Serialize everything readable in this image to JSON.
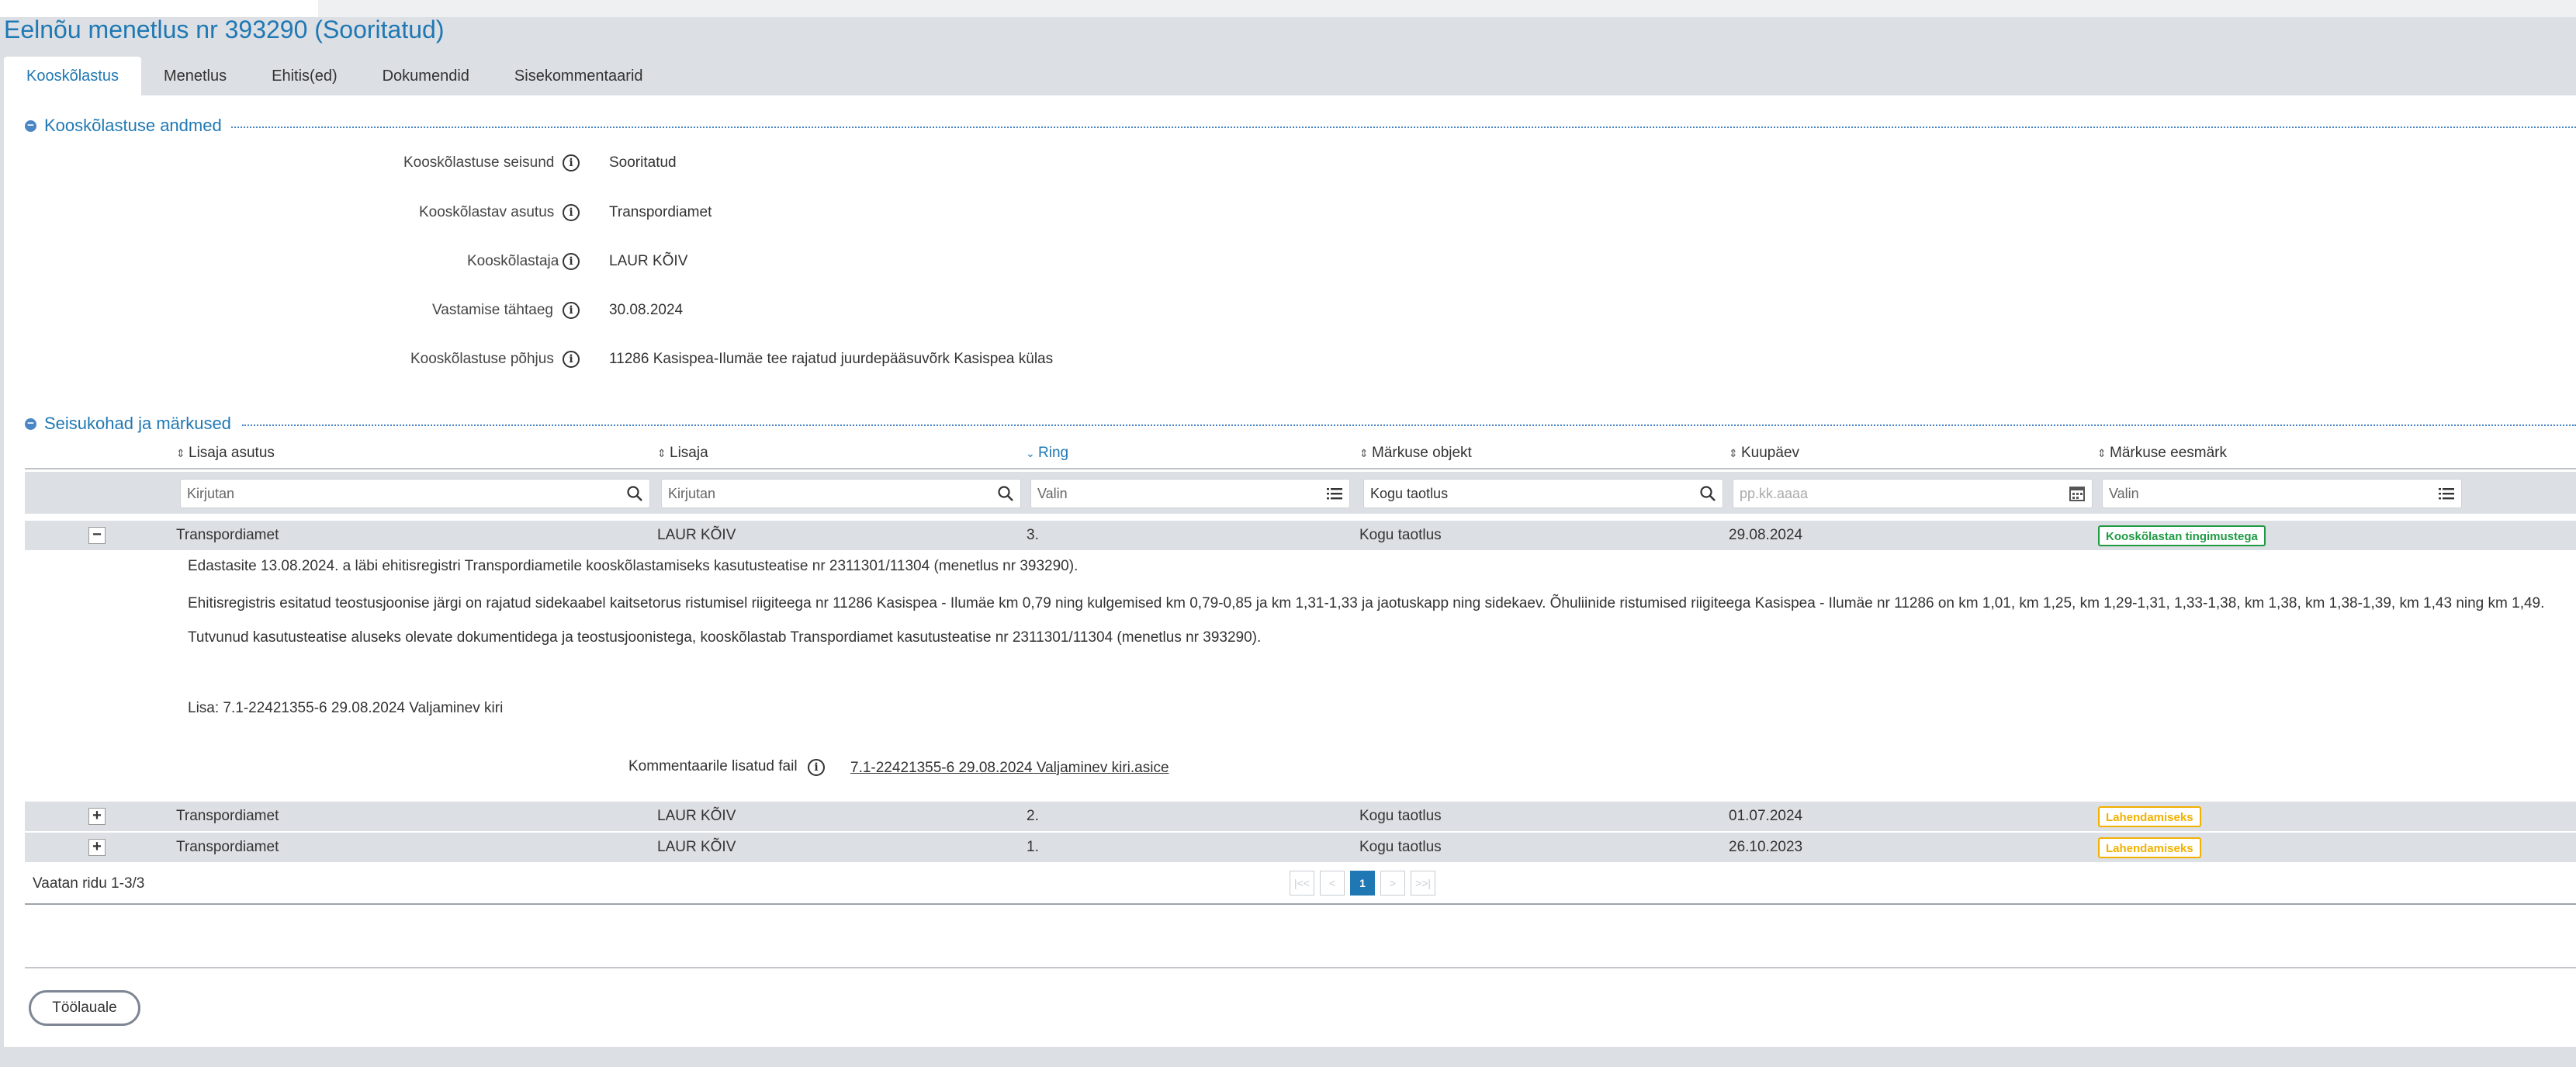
{
  "page": {
    "title": "Eelnõu menetlus nr 393290 (Sooritatud)"
  },
  "tabs": [
    {
      "label": "Kooskõlastus",
      "active": true
    },
    {
      "label": "Menetlus",
      "active": false
    },
    {
      "label": "Ehitis(ed)",
      "active": false
    },
    {
      "label": "Dokumendid",
      "active": false
    },
    {
      "label": "Sisekommentaarid",
      "active": false
    }
  ],
  "section1": {
    "title": "Kooskõlastuse andmed",
    "fields": [
      {
        "label": "Kooskõlastuse seisund",
        "value": "Sooritatud"
      },
      {
        "label": "Kooskõlastav asutus",
        "value": "Transpordiamet"
      },
      {
        "label": "Kooskõlastaja",
        "value": "LAUR KÕIV"
      },
      {
        "label": "Vastamise tähtaeg",
        "value": "30.08.2024"
      },
      {
        "label": "Kooskõlastuse põhjus",
        "value": "11286 Kasispea-Ilumäe tee rajatud juurdepääsuvõrk Kasispea külas"
      }
    ]
  },
  "section2": {
    "title": "Seisukohad ja märkused",
    "columns": [
      {
        "label": "Lisaja asutus",
        "sort": "unsorted"
      },
      {
        "label": "Lisaja",
        "sort": "unsorted"
      },
      {
        "label": "Ring",
        "sort": "descending"
      },
      {
        "label": "Märkuse objekt",
        "sort": "unsorted"
      },
      {
        "label": "Kuupäev",
        "sort": "unsorted"
      },
      {
        "label": "Märkuse eesmärk",
        "sort": "unsorted"
      }
    ],
    "filters": [
      {
        "placeholder": "Kirjutan",
        "icon": "search-icon"
      },
      {
        "placeholder": "Kirjutan",
        "icon": "search-icon"
      },
      {
        "placeholder": "Valin",
        "icon": "list-icon"
      },
      {
        "placeholder": "Kogu taotlus",
        "icon": "search-icon"
      },
      {
        "placeholder": "pp.kk.aaaa",
        "icon": "calendar-icon"
      },
      {
        "placeholder": "Valin",
        "icon": "list-icon"
      }
    ],
    "rows": [
      {
        "toggle": "−",
        "expanded": true,
        "organization": "Transpordiamet",
        "author": "LAUR KÕIV",
        "round": "3.",
        "object": "Kogu taotlus",
        "date": "29.08.2024",
        "purpose": "Kooskõlastan tingimustega",
        "purpose_color": "#1f9a43"
      },
      {
        "toggle": "+",
        "expanded": false,
        "organization": "Transpordiamet",
        "author": "LAUR KÕIV",
        "round": "2.",
        "object": "Kogu taotlus",
        "date": "01.07.2024",
        "purpose": "Lahendamiseks",
        "purpose_color": "#f2b100"
      },
      {
        "toggle": "+",
        "expanded": false,
        "organization": "Transpordiamet",
        "author": "LAUR KÕIV",
        "round": "1.",
        "object": "Kogu taotlus",
        "date": "26.10.2023",
        "purpose": "Lahendamiseks",
        "purpose_color": "#f2b100"
      }
    ],
    "detail": {
      "paragraphs": [
        "Edastasite 13.08.2024. a läbi ehitisregistri Transpordiametile kooskõlastamiseks kasutusteatise nr 2311301/11304 (menetlus nr 393290).",
        "Ehitisregistris esitatud teostusjoonise järgi on rajatud sidekaabel kaitsetorus ristumisel riigiteega nr 11286 Kasispea - Ilumäe km 0,79 ning kulgemised km 0,79-0,85 ja km 1,31-1,33 ja jaotuskapp ning sidekaev. Õhuliinide ristumised riigiteega Kasispea - Ilumäe nr 11286 on km 1,01, km 1,25, km 1,29-1,31, 1,33-1,38, km 1,38, km 1,38-1,39, km 1,43 ning km 1,49.",
        "Tutvunud kasutusteatise aluseks olevate dokumentidega ja teostusjoonistega, kooskõlastab Transpordiamet kasutusteatise nr 2311301/11304 (menetlus nr 393290).",
        "Lisa: 7.1-22421355-6 29.08.2024 Valjaminev kiri"
      ],
      "file_label": "Kommentaarile lisatud fail",
      "file_name": "7.1-22421355-6 29.08.2024 Valjaminev kiri.asice"
    },
    "footer": {
      "rows_text": "Vaatan ridu 1-3/3",
      "pager": [
        "|<<",
        "<",
        "1",
        ">",
        ">>|"
      ],
      "current_page": "1"
    }
  },
  "actions": {
    "back_label": "Töölauale"
  },
  "colors": {
    "accent": "#1f78b4",
    "approve": "#1f9a43",
    "resolve": "#f2b100",
    "band": "#dcdfe3"
  }
}
